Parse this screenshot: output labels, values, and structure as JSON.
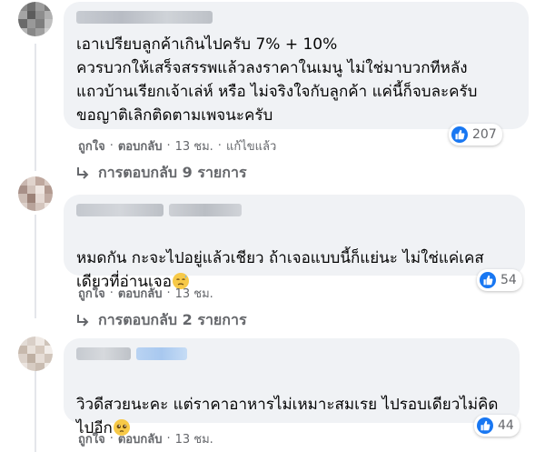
{
  "comments": [
    {
      "text": "เอาเปรียบลูกค้าเกินไปครับ 7% + 10%\nควรบวกให้เสร็จสรรพแล้วลงราคาในเมนู ไม่ใช่มาบวกทีหลัง\nแถวบ้านเรียกเจ้าเล่ห์ หรือ ไม่จริงใจกับลูกค้า แค่นี้ก็จบละครับ\nขอญาติเลิกติดตามเพจนะครับ",
      "reaction_count": "207",
      "like_label": "ถูกใจ",
      "reply_label": "ตอบกลับ",
      "time": "13 ชม.",
      "edited_label": "แก้ไขแล้ว",
      "replies_label": "การตอบกลับ 9 รายการ"
    },
    {
      "text": "หมดกัน กะจะไปอยู่แล้วเชียว ถ้าเจอแบบนี้ก็แย่นะ ไม่ใช่แค่เคส\nเดียวที่อ่านเจอ",
      "emoji": "downcast-sweat-face",
      "reaction_count": "54",
      "like_label": "ถูกใจ",
      "reply_label": "ตอบกลับ",
      "time": "13 ชม.",
      "replies_label": "การตอบกลับ 2 รายการ"
    },
    {
      "text": "วิวดีสวยนะคะ แต่ราคาอาหารไม่เหมาะสมเรย ไปรอบเดียวไม่คิด\nไปอีก",
      "emoji": "pleading-face",
      "reaction_count": "44",
      "like_label": "ถูกใจ",
      "reply_label": "ตอบกลับ",
      "time": "13 ชม."
    }
  ],
  "colors": {
    "bubble": "#f0f2f5",
    "meta_text": "#65676b",
    "like_blue": "#1877f2"
  }
}
